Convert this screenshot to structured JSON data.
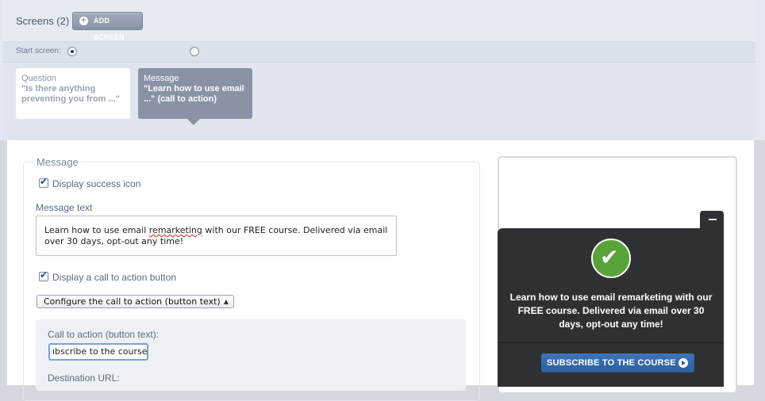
{
  "screens": {
    "title": "Screens (2)",
    "add_button": "ADD SCREEN",
    "start_label": "Start screen:"
  },
  "cards": [
    {
      "type": "Question",
      "text": "\"Is there anything preventing you from ...\""
    },
    {
      "type": "Message",
      "text": "\"Learn how to use email ...\" (call to action)"
    }
  ],
  "form": {
    "legend": "Message",
    "display_success_icon": "Display success icon",
    "message_text_label": "Message text",
    "message_text_pre": "Learn how to use email ",
    "message_text_squiggle": "remarketing",
    "message_text_post": " with our FREE course. Delivered via email over 30 days, opt-out any time!",
    "display_cta": "Display a call to action button",
    "configure_select": "Configure the call to action (button text)",
    "cta_label": "Call to action (button text):",
    "cta_value": "ıbscribe to the course",
    "destination_label": "Destination URL:"
  },
  "preview": {
    "message": "Learn how to use email remarketing with our FREE course. Delivered via email over 30 days, opt-out any time!",
    "button": "SUBSCRIBE TO THE COURSE"
  },
  "colors": {
    "success_green": "#5aa33a",
    "cta_blue": "#2c5f9f",
    "popup_bg": "#2f3033"
  }
}
